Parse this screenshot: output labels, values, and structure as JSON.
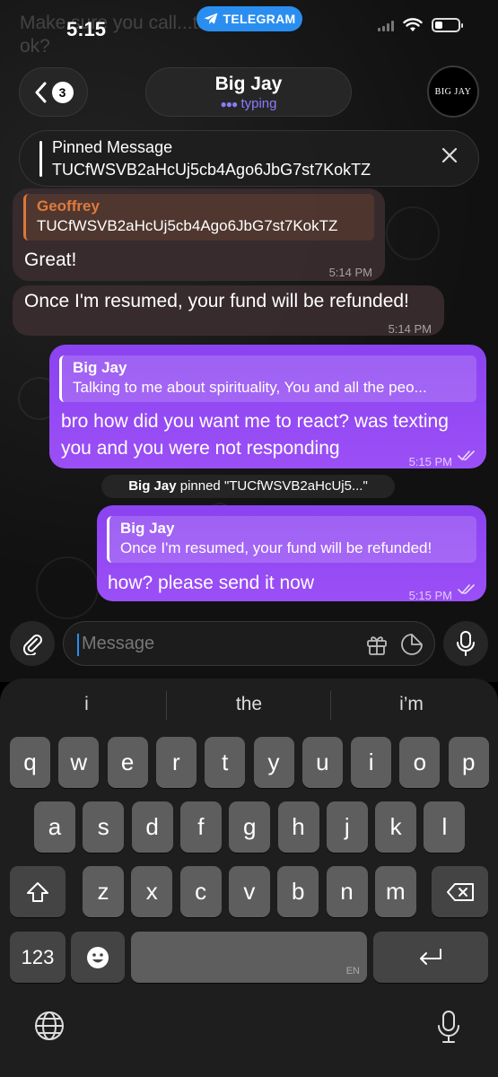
{
  "status_bar": {
    "time": "5:15",
    "app_badge": "TELEGRAM"
  },
  "header": {
    "back_count": "3",
    "chat_name": "Big Jay",
    "chat_status": "typing",
    "avatar_text": "BIG JAY"
  },
  "background_ghost": {
    "line1": "Make sure you call...talk to them",
    "line2": "ok?"
  },
  "pinned": {
    "title": "Pinned Message",
    "text": "TUCfWSVB2aHcUj5cb4Ago6JbG7st7KokTZ"
  },
  "messages": [
    {
      "direction": "in",
      "reply_name": "Geoffrey",
      "reply_text": "TUCfWSVB2aHcUj5cb4Ago6JbG7st7KokTZ",
      "text": "Great!",
      "time": "5:14 PM"
    },
    {
      "direction": "in",
      "text": "Once I'm resumed, your fund will be refunded!",
      "time": "5:14 PM"
    },
    {
      "direction": "out",
      "reply_name": "Big Jay",
      "reply_text": "Talking to me about spirituality, You and all the peo...",
      "text_line1": "bro how did you want me to react? was texting",
      "text_line2": "you and you were not responding",
      "time": "5:15 PM"
    },
    {
      "direction": "out",
      "reply_name": "Big Jay",
      "reply_text": "Once I'm resumed, your fund will be refunded!",
      "text": "how? please send it now",
      "time": "5:15 PM"
    }
  ],
  "service_message": {
    "actor": "Big Jay",
    "action": " pinned \"TUCfWSVB2aHcUj5...\""
  },
  "composer": {
    "placeholder": "Message"
  },
  "keyboard": {
    "suggestions": [
      "i",
      "the",
      "i’m"
    ],
    "row1": [
      "q",
      "w",
      "e",
      "r",
      "t",
      "y",
      "u",
      "i",
      "o",
      "p"
    ],
    "row2": [
      "a",
      "s",
      "d",
      "f",
      "g",
      "h",
      "j",
      "k",
      "l"
    ],
    "row3": [
      "z",
      "x",
      "c",
      "v",
      "b",
      "n",
      "m"
    ],
    "numbers_key": "123",
    "space_lang": "EN"
  },
  "colors": {
    "accent": "#2a8ef0",
    "outgoing_bubble": "#9146f3",
    "incoming_bubble": "#3a2c30",
    "reply_orange": "#e07a3a",
    "typing_purple": "#8a7cff"
  },
  "icons": [
    "telegram-plane-icon",
    "chevron-left-icon",
    "close-icon",
    "paperclip-icon",
    "gift-icon",
    "sticker-icon",
    "microphone-icon",
    "double-check-icon",
    "shift-icon",
    "backspace-icon",
    "emoji-icon",
    "return-icon",
    "globe-icon",
    "dictation-icon"
  ]
}
